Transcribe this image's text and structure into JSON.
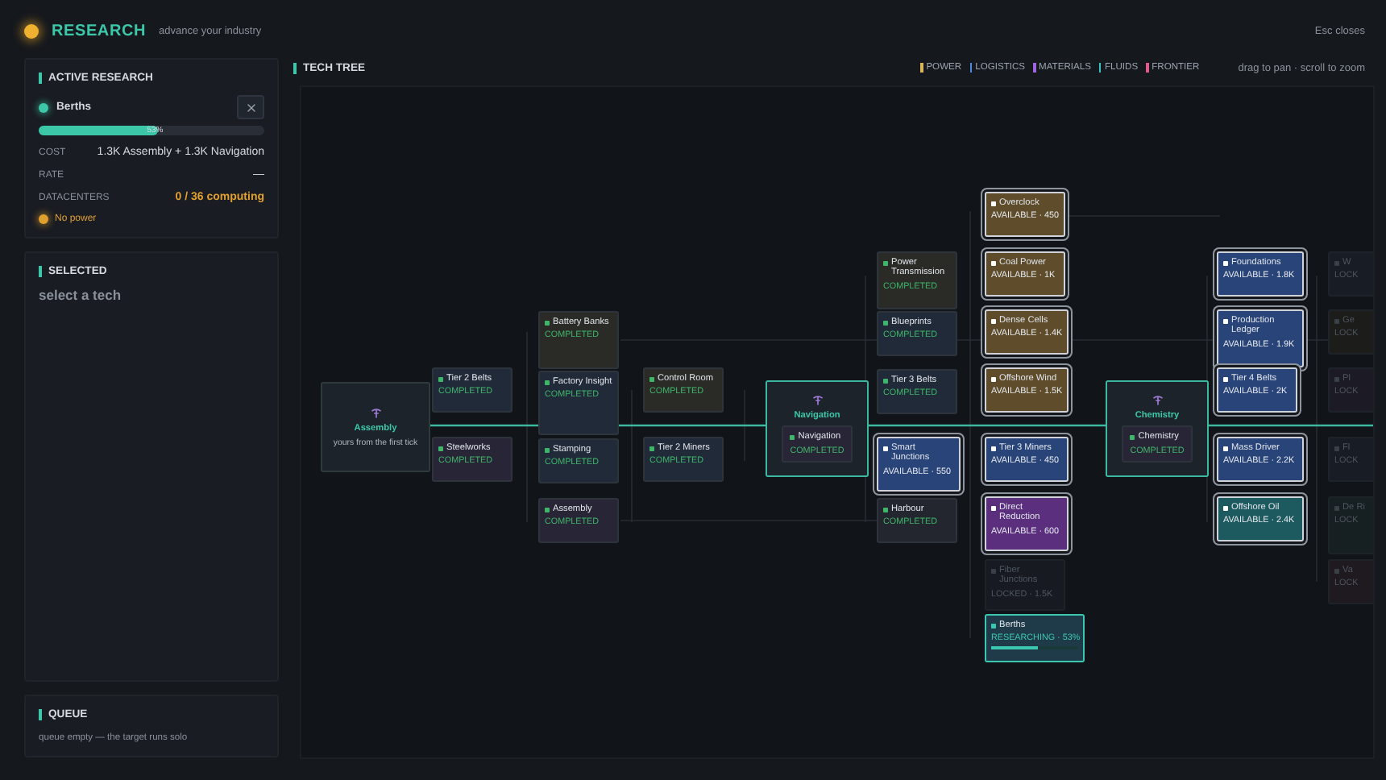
{
  "header": {
    "title": "RESEARCH",
    "subtitle": "advance your industry",
    "hint": "Esc closes"
  },
  "active_research": {
    "heading": "ACTIVE RESEARCH",
    "name": "Berths",
    "level": 0.53,
    "percent": "53%",
    "rows": [
      {
        "label": "COST",
        "value": "1.3K Assembly + 1.3K Navigation",
        "kind": "plain"
      },
      {
        "label": "RATE",
        "value": "—",
        "kind": "plain"
      },
      {
        "label": "DATACENTERS",
        "value": "0 / 36 computing",
        "kind": "warning"
      }
    ],
    "power_warning": "No power"
  },
  "selected": {
    "heading": "SELECTED",
    "prompt": "select a tech"
  },
  "queue": {
    "heading": "QUEUE",
    "text": "queue empty — the target runs solo"
  },
  "tree": {
    "heading": "TECH TREE",
    "hint": "drag to pan · scroll to zoom",
    "legend": [
      {
        "label": "POWER",
        "color": "#d8b45a"
      },
      {
        "label": "LOGISTICS",
        "color": "#4a8ae0"
      },
      {
        "label": "MATERIALS",
        "color": "#a064e0"
      },
      {
        "label": "FLUIDS",
        "color": "#3cc0c8"
      },
      {
        "label": "FRONTIER",
        "color": "#e05a8a"
      }
    ],
    "nodes": [
      {
        "kind": "milestone",
        "title": "Assembly",
        "subtitle": "yours from the first tick"
      },
      {
        "kind": "completed",
        "name": "Tier 2 Belts",
        "status_text": "COMPLETED",
        "color": "#212a38"
      },
      {
        "kind": "completed",
        "name": "Steelworks",
        "status_text": "COMPLETED",
        "color": "#282536"
      },
      {
        "kind": "completed",
        "name": "Battery Banks",
        "status_text": "COMPLETED",
        "color": "#2a2a26"
      },
      {
        "kind": "completed",
        "name": "Factory Insight",
        "status_text": "COMPLETED",
        "color": "#212a38"
      },
      {
        "kind": "completed",
        "name": "Stamping",
        "status_text": "COMPLETED",
        "color": "#212a38"
      },
      {
        "kind": "completed",
        "name": "Assembly",
        "status_text": "COMPLETED",
        "color": "#282536"
      },
      {
        "kind": "completed",
        "name": "Control Room",
        "status_text": "COMPLETED",
        "color": "#2a2a26"
      },
      {
        "kind": "completed",
        "name": "Tier 2 Miners",
        "status_text": "COMPLETED",
        "color": "#212a38"
      },
      {
        "kind": "milestone",
        "title": "Navigation",
        "inner": {
          "kind": "completed",
          "name": "Navigation",
          "status_text": "COMPLETED",
          "color": "#282536"
        }
      },
      {
        "kind": "completed",
        "name": "Power Transmission",
        "status_text": "COMPLETED",
        "color": "#2a2a26"
      },
      {
        "kind": "completed",
        "name": "Blueprints",
        "status_text": "COMPLETED",
        "color": "#212a38"
      },
      {
        "kind": "completed",
        "name": "Tier 3 Belts",
        "status_text": "COMPLETED",
        "color": "#212a38"
      },
      {
        "kind": "available",
        "name": "Smart Junctions",
        "status_text": "AVAILABLE · 550",
        "color": "#284478"
      },
      {
        "kind": "completed",
        "name": "Harbour",
        "status_text": "COMPLETED",
        "color": "#23262e"
      },
      {
        "kind": "available",
        "name": "Overclock",
        "status_text": "AVAILABLE · 450",
        "color": "#5e4c2a"
      },
      {
        "kind": "available",
        "name": "Coal Power",
        "status_text": "AVAILABLE · 1K",
        "color": "#5e4c2a"
      },
      {
        "kind": "available",
        "name": "Dense Cells",
        "status_text": "AVAILABLE · 1.4K",
        "color": "#5e4c2a"
      },
      {
        "kind": "available",
        "name": "Offshore Wind",
        "status_text": "AVAILABLE · 1.5K",
        "color": "#5e4c2a"
      },
      {
        "kind": "available",
        "name": "Tier 3 Miners",
        "status_text": "AVAILABLE · 450",
        "color": "#284478"
      },
      {
        "kind": "available",
        "name": "Direct Reduction",
        "status_text": "AVAILABLE · 600",
        "color": "#5b2f7e"
      },
      {
        "kind": "locked",
        "name": "Fiber Junctions",
        "status_text": "LOCKED · 1.5K",
        "color": "#171b21"
      },
      {
        "kind": "researching",
        "name": "Berths",
        "status_text": "RESEARCHING · 53%",
        "color": "#1f3a48",
        "level": 0.53
      },
      {
        "kind": "milestone",
        "title": "Chemistry",
        "inner": {
          "kind": "completed",
          "name": "Chemistry",
          "status_text": "COMPLETED",
          "color": "#282536"
        }
      },
      {
        "kind": "available",
        "name": "Foundations",
        "status_text": "AVAILABLE · 1.8K",
        "color": "#284478"
      },
      {
        "kind": "available",
        "name": "Production Ledger",
        "status_text": "AVAILABLE · 1.9K",
        "color": "#284478"
      },
      {
        "kind": "available",
        "name": "Tier 4 Belts",
        "status_text": "AVAILABLE · 2K",
        "color": "#284478"
      },
      {
        "kind": "available",
        "name": "Mass Driver",
        "status_text": "AVAILABLE · 2.2K",
        "color": "#284478"
      },
      {
        "kind": "available",
        "name": "Offshore Oil",
        "status_text": "AVAILABLE · 2.4K",
        "color": "#1d5a60"
      },
      {
        "kind": "locked",
        "name": "W",
        "status_text": "LOCK",
        "color": "#181c24"
      },
      {
        "kind": "locked",
        "name": "Ge",
        "status_text": "LOCK",
        "color": "#1c1c1a"
      },
      {
        "kind": "locked",
        "name": "Pl",
        "status_text": "LOCK",
        "color": "#1c1a24"
      },
      {
        "kind": "locked",
        "name": "Fl",
        "status_text": "LOCK",
        "color": "#181c24"
      },
      {
        "kind": "locked",
        "name": "De Ri",
        "status_text": "LOCK",
        "color": "#162022"
      },
      {
        "kind": "locked",
        "name": "Va",
        "status_text": "LOCK",
        "color": "#1e1a20"
      }
    ]
  }
}
